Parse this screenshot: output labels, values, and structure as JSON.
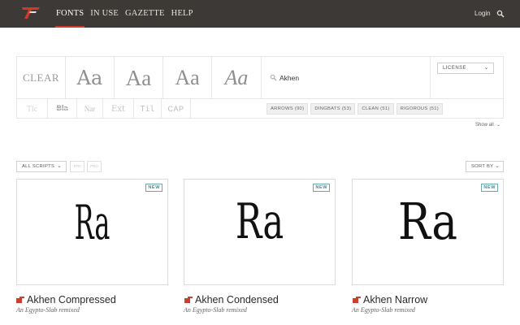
{
  "nav": {
    "items": [
      "FONTS",
      "IN USE",
      "GAZETTE",
      "HELP"
    ],
    "login": "Login"
  },
  "filters": {
    "styles": [
      {
        "label": "CLEAR",
        "name": "clear"
      },
      {
        "label": "Aa",
        "name": "serif"
      },
      {
        "label": "Aa",
        "name": "slab"
      },
      {
        "label": "Aa",
        "name": "serif-light"
      },
      {
        "label": "Aa",
        "name": "italic"
      }
    ],
    "search_value": "Akhen",
    "license": "LICENSE",
    "kinds": [
      "Tlc",
      "Bla",
      "Nar",
      "Ext",
      "Til",
      "CAP"
    ],
    "tags": [
      "ARROWS (90)",
      "DINGBATS (53)",
      "CLEAN (51)",
      "RIGOROUS (51)"
    ],
    "show_all": "Show all"
  },
  "controls": {
    "scripts": "ALL SCRIPTS",
    "mini1": "STD",
    "mini2": "PRO",
    "sort": "SORT BY"
  },
  "cards": [
    {
      "name": "Akhen Compressed",
      "subtitle": "An Egypto-Slab remixed",
      "sample": "Ra",
      "badge": "NEW"
    },
    {
      "name": "Akhen Condensed",
      "subtitle": "An Egypto-Slab remixed",
      "sample": "Ra",
      "badge": "NEW"
    },
    {
      "name": "Akhen Narrow",
      "subtitle": "An Egypto-Slab remixed",
      "sample": "Ra",
      "badge": "NEW"
    }
  ],
  "colors": {
    "topbar": "#3c3936",
    "accent": "#d03a2a",
    "badge": "#4a8c96"
  },
  "icons": {
    "logo": "logo-icon",
    "search": "search-icon",
    "hand": "pointing-hand-icon",
    "chevron": "chevron-down-icon"
  }
}
